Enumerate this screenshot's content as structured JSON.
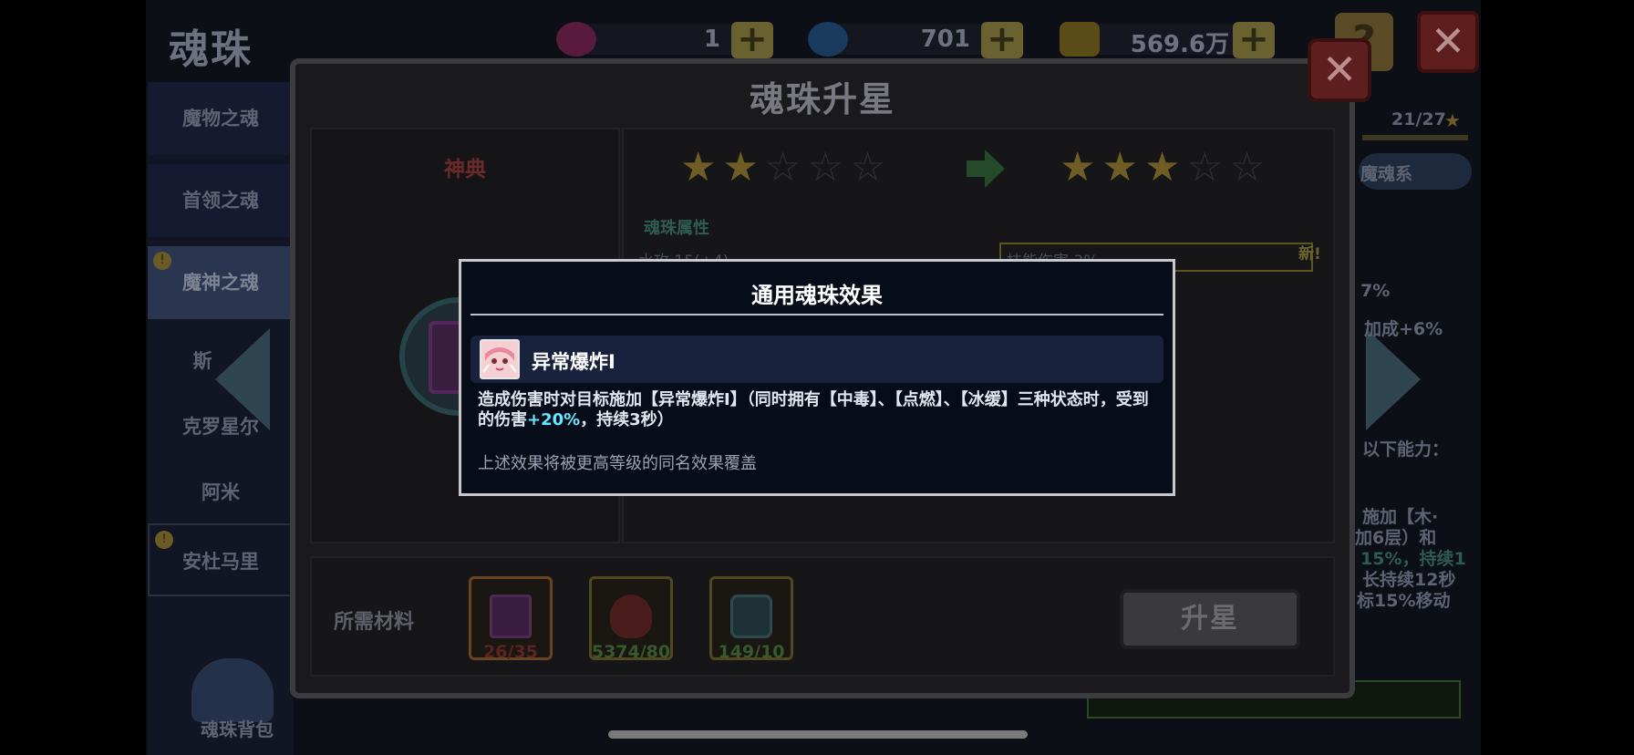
{
  "screen": {
    "title": "魂珠",
    "resources": [
      {
        "name": "pink-gem",
        "value": "1",
        "color": "#7a1d4a"
      },
      {
        "name": "blue-gem",
        "value": "701",
        "color": "#1d4a7a"
      },
      {
        "name": "gold-coin",
        "value": "569.6万",
        "color": "#6a5818"
      }
    ]
  },
  "sidebar": {
    "items": [
      {
        "label": "魔物之魂"
      },
      {
        "label": "首领之魂"
      },
      {
        "label": "魔神之魂"
      },
      {
        "label": "斯"
      },
      {
        "label": "克罗星尔"
      },
      {
        "label": "阿米"
      },
      {
        "label": "安杜马里"
      }
    ],
    "bag_label": "魂珠背包"
  },
  "right_panel": {
    "progress": "21/27",
    "tab": "魔魂系",
    "lines": [
      "7%",
      "加成+6%",
      "以下能力：",
      "施加【木·",
      "加6层）和",
      "15%，持续1",
      "长持续12秒",
      "标15%移动"
    ]
  },
  "upgrade": {
    "title": "魂珠升星",
    "item_name": "神典",
    "stars_before": 2,
    "stars_after": 3,
    "stars_total": 5,
    "attr_label": "魂珠属性",
    "ghost_texts": [
      "水攻 15(+4)",
      "技能伤害 3%",
      "新!",
      "新!"
    ],
    "materials_label": "所需材料",
    "materials": [
      {
        "name": "soul-book",
        "count": "26/35",
        "count_color": "#5c2323"
      },
      {
        "name": "red-crystal",
        "count": "5374/80",
        "count_color": "#355a2e"
      },
      {
        "name": "star-jar",
        "count": "149/10",
        "count_color": "#355a2e"
      }
    ],
    "upgrade_button": "升星"
  },
  "modal": {
    "title": "通用魂珠效果",
    "effect_name": "异常爆炸Ⅰ",
    "desc_part1": "造成伤害时对目标施加【异常爆炸Ⅰ】（同时拥有【中毒】、【点燃】、【冰缓】三种状态时，受到的伤害",
    "desc_highlight": "+20%",
    "desc_part2": "，持续3秒）",
    "note": "上述效果将被更高等级的同名效果覆盖"
  }
}
